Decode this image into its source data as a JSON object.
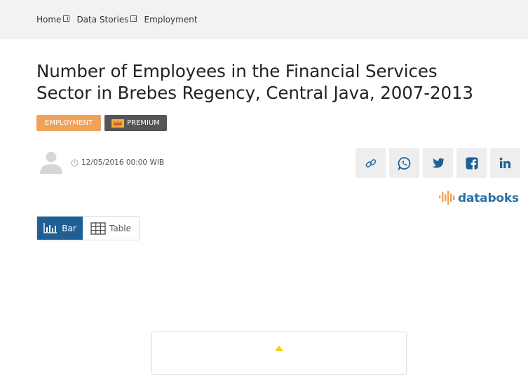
{
  "breadcrumb": {
    "items": [
      "Home",
      "Data Stories",
      "Employment"
    ]
  },
  "article": {
    "title_line1": "Number of Employees in the Financial Services",
    "title_line2": "Sector in Brebes Regency, Central Java, 2007-2013",
    "category_tag": "EMPLOYMENT",
    "premium_label": "PREMIUM",
    "date": "12/05/2016 00:00 WIB"
  },
  "share": {
    "icons": [
      "link-icon",
      "whatsapp-icon",
      "twitter-icon",
      "facebook-icon",
      "linkedin-icon"
    ]
  },
  "brand": {
    "name": "databoks"
  },
  "view_toggle": {
    "bar_label": "Bar",
    "table_label": "Table",
    "active": "Bar"
  },
  "colors": {
    "accent": "#1f5f94",
    "tag": "#f0a25a",
    "premium_bg": "#555555",
    "brand": "#2b6ea3",
    "brand_bars": "#f0a25a"
  }
}
